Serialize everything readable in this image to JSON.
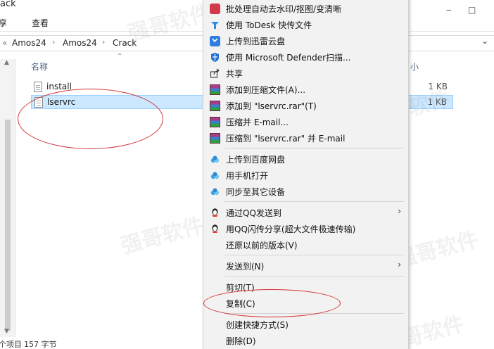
{
  "window": {
    "title_fragment": "ack",
    "ribbon_tabs": [
      "享",
      "查看"
    ],
    "breadcrumb": [
      "Amos24",
      "Amos24",
      "Crack"
    ],
    "breadcrumb_lead": "«"
  },
  "file_list": {
    "name_header": "名称",
    "size_header": "小",
    "files": [
      {
        "name": "install",
        "size": "1 KB"
      },
      {
        "name": "lservrc",
        "size": "1 KB"
      }
    ]
  },
  "status_bar": {
    "items_label": "个项目",
    "size_label": "157 字节"
  },
  "watermark_text": "强哥软件",
  "context_menu": {
    "items": [
      {
        "label": "批处理自动去水印/抠图/变清晰",
        "icon": "photo-tool-icon"
      },
      {
        "label": "使用 ToDesk 快传文件",
        "icon": "todesk-icon"
      },
      {
        "label": "上传到迅雷云盘",
        "icon": "xunlei-icon"
      },
      {
        "label": "使用 Microsoft Defender扫描...",
        "icon": "defender-shield-icon"
      },
      {
        "label": "共享",
        "icon": "share-icon"
      },
      {
        "label": "添加到压缩文件(A)...",
        "icon": "winrar-icon"
      },
      {
        "label": "添加到 \"lservrc.rar\"(T)",
        "icon": "winrar-icon"
      },
      {
        "label": "压缩并 E-mail...",
        "icon": "winrar-icon"
      },
      {
        "label": "压缩到 \"lservrc.rar\" 并 E-mail",
        "icon": "winrar-icon"
      },
      {
        "label": "上传到百度网盘",
        "icon": "baidu-cloud-icon"
      },
      {
        "label": "用手机打开",
        "icon": "baidu-cloud-icon"
      },
      {
        "label": "同步至其它设备",
        "icon": "baidu-cloud-icon"
      },
      {
        "label": "通过QQ发送到",
        "icon": "qq-icon",
        "submenu": true
      },
      {
        "label": "用QQ闪传分享(超大文件极速传输)",
        "icon": "qq-icon"
      },
      {
        "label": "还原以前的版本(V)"
      },
      {
        "label": "发送到(N)",
        "submenu": true
      },
      {
        "label": "剪切(T)"
      },
      {
        "label": "复制(C)"
      },
      {
        "label": "创建快捷方式(S)"
      },
      {
        "label": "删除(D)"
      }
    ]
  },
  "colors": {
    "annotation_red": "#d23030",
    "selection": "#cce8ff",
    "menu_bg": "#f2f2f2"
  }
}
